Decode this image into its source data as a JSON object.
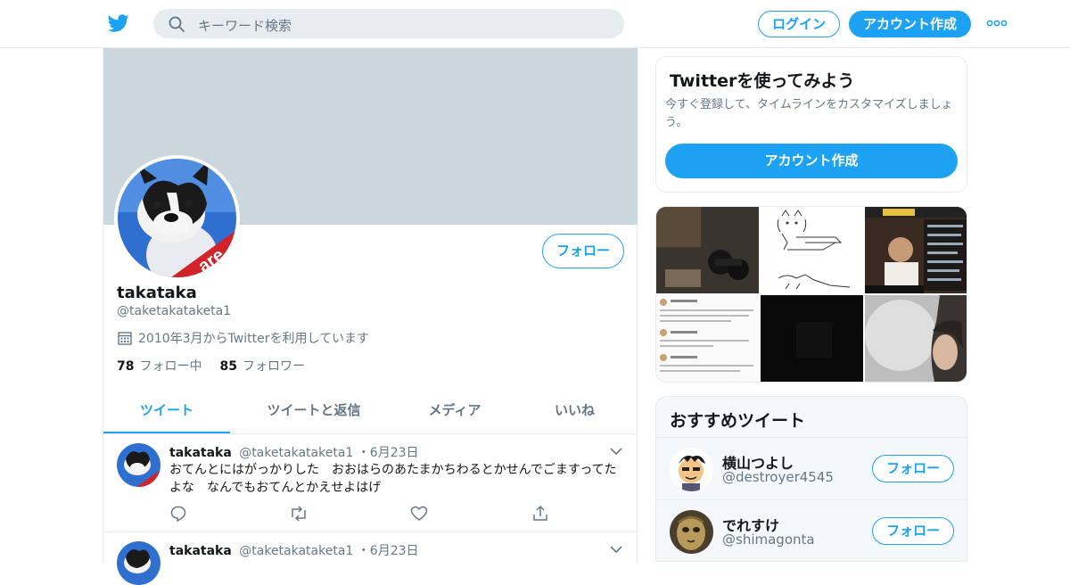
{
  "header": {
    "search_placeholder": "キーワード検索",
    "login_label": "ログイン",
    "signup_label": "アカウント作成"
  },
  "profile": {
    "name": "takataka",
    "handle": "@taketakataketa1",
    "joined": "2010年3月からTwitterを利用しています",
    "following_count": "78",
    "following_label": "フォロー中",
    "followers_count": "85",
    "followers_label": "フォロワー",
    "follow_label": "フォロー"
  },
  "tabs": [
    {
      "label": "ツイート"
    },
    {
      "label": "ツイートと返信"
    },
    {
      "label": "メディア"
    },
    {
      "label": "いいね"
    }
  ],
  "tweets": [
    {
      "name": "takataka",
      "handle": "@taketakataketa1",
      "date": "・6月23日",
      "text": "おてんとにはがっかりした　おおはらのあたまかちわるとかせんでごますってたよな　なんでもおてんとかえせよはげ"
    },
    {
      "name": "takataka",
      "handle": "@taketakataketa1",
      "date": "・6月23日",
      "text": ""
    }
  ],
  "signup_card": {
    "title": "Twitterを使ってみよう",
    "description": "今すぐ登録して、タイムラインをカスタマイズしましょう。",
    "button": "アカウント作成"
  },
  "recommended": {
    "title": "おすすめツイート",
    "accounts": [
      {
        "name": "横山つよし",
        "handle": "@destroyer4545",
        "follow_label": "フォロー"
      },
      {
        "name": "でれすけ",
        "handle": "@shimagonta",
        "follow_label": "フォロー"
      }
    ]
  },
  "colors": {
    "accent": "#1da1f2",
    "banner": "#ccd6dd",
    "muted_text": "#657786"
  }
}
